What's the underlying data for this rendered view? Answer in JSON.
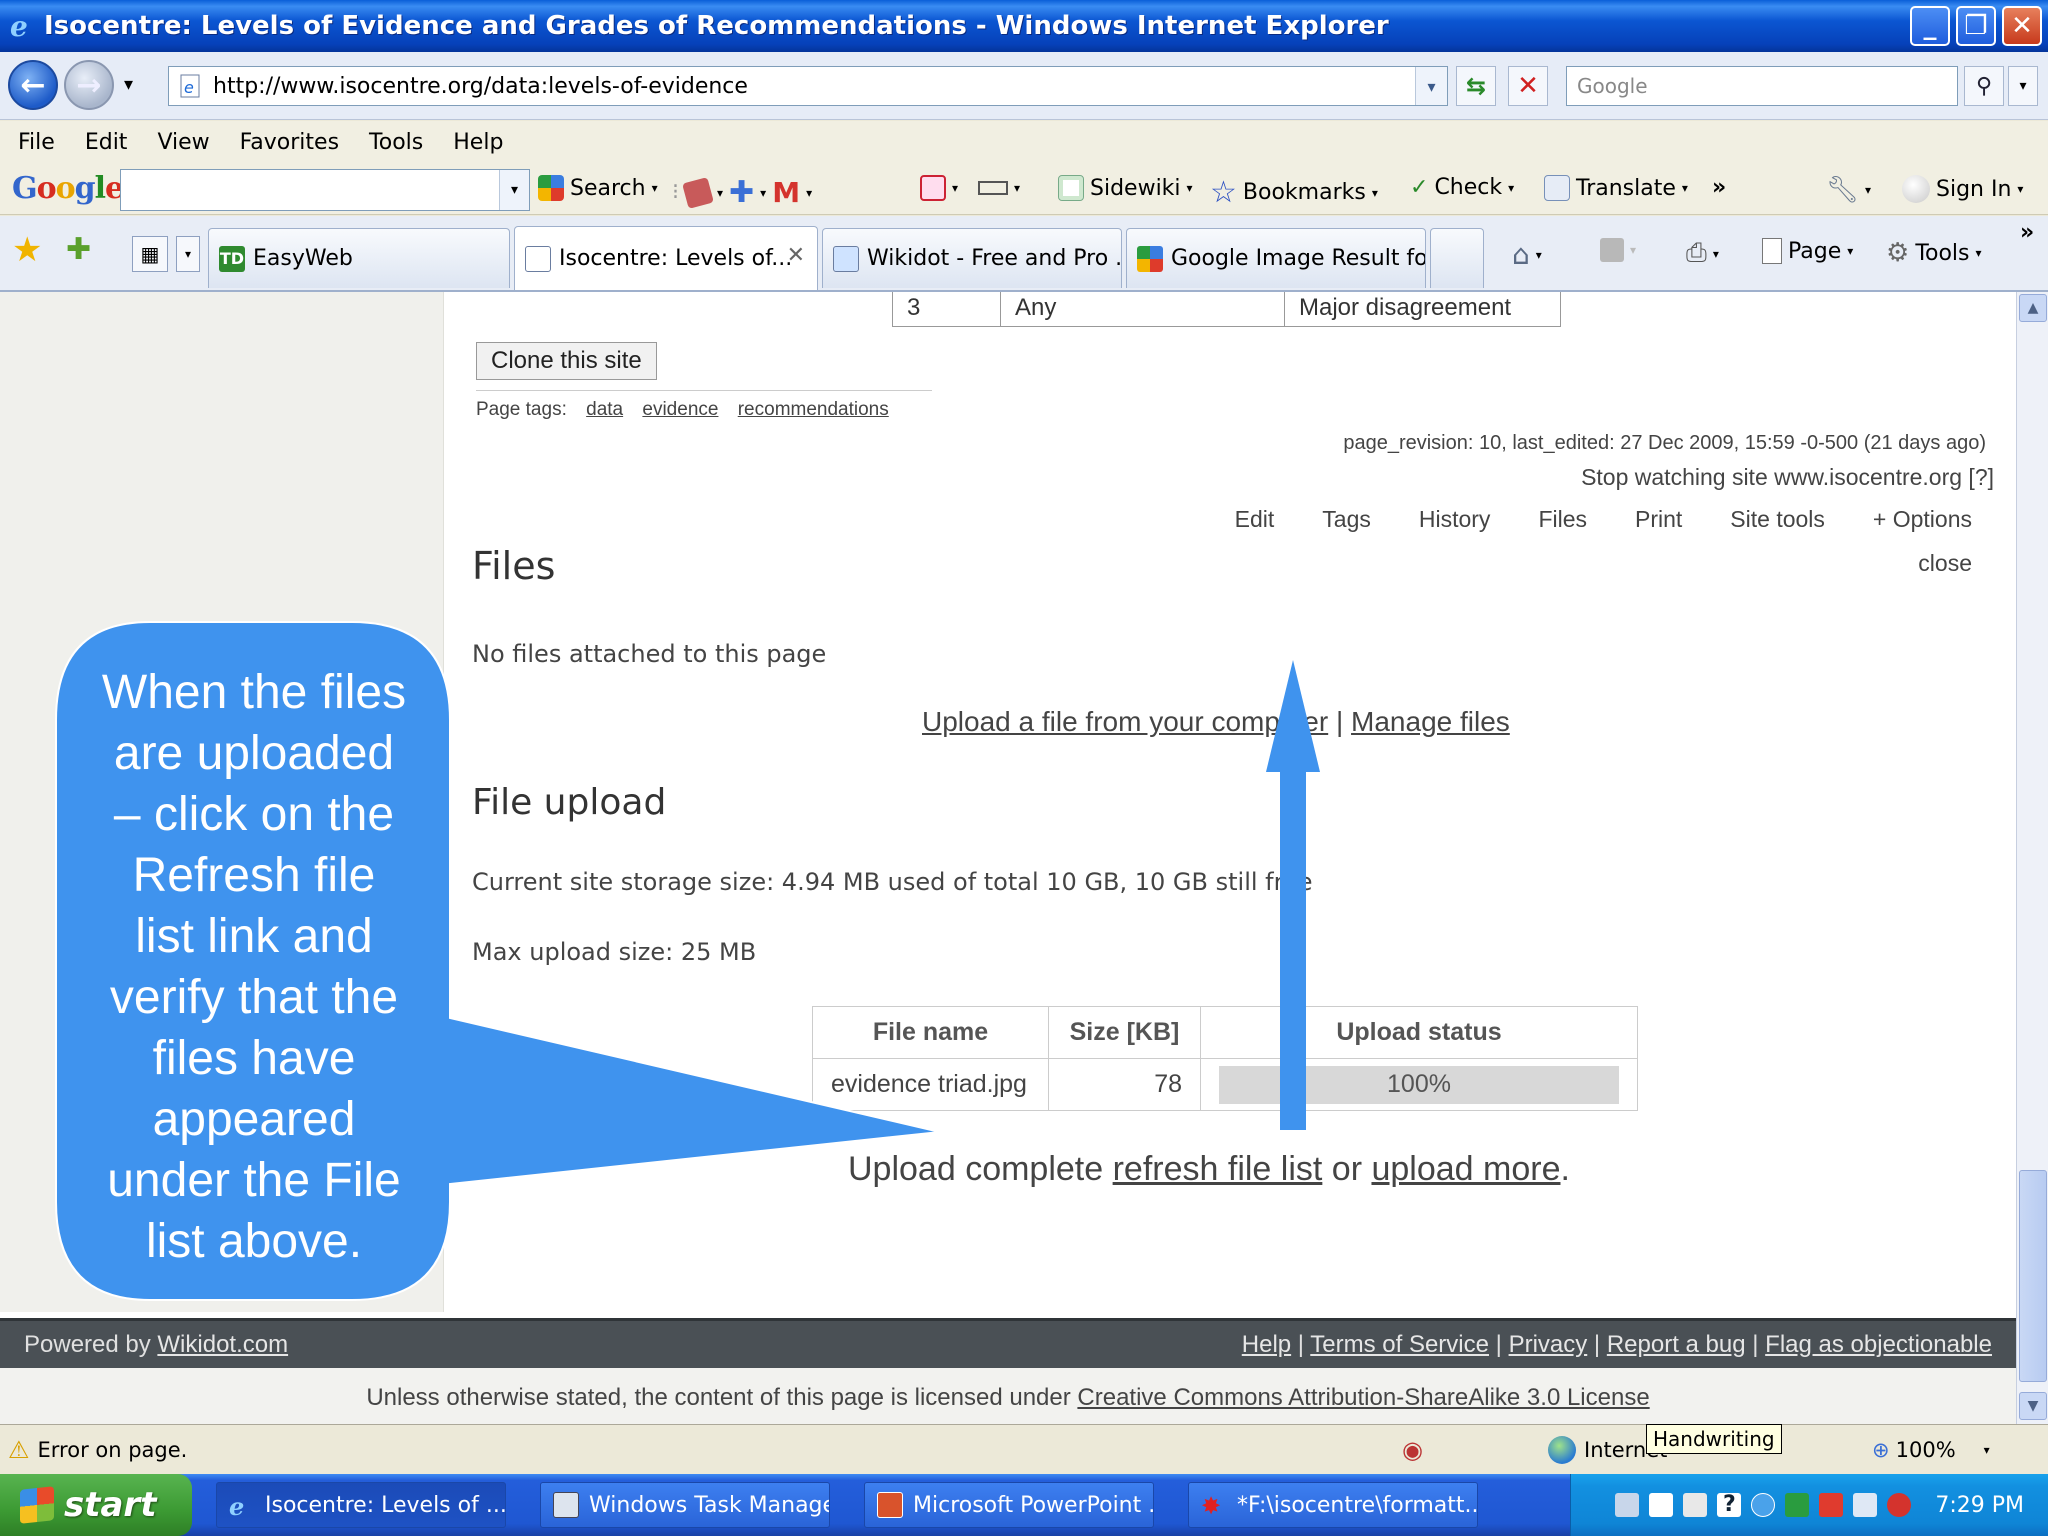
{
  "window": {
    "title": "Isocentre: Levels of Evidence and Grades of Recommendations - Windows Internet Explorer",
    "buttons": {
      "minimize": "_",
      "maximize": "❐",
      "close": "✕"
    }
  },
  "address_bar": {
    "url": "http://www.isocentre.org/data:levels-of-evidence",
    "search_placeholder": "Google"
  },
  "menu": [
    "File",
    "Edit",
    "View",
    "Favorites",
    "Tools",
    "Help"
  ],
  "google_toolbar": {
    "logo": [
      "G",
      "o",
      "o",
      "g",
      "l",
      "e"
    ],
    "search_label": "Search",
    "sidewiki_label": "Sidewiki",
    "bookmarks_label": "Bookmarks",
    "check_label": "Check",
    "translate_label": "Translate",
    "more": "»",
    "signin_label": "Sign In"
  },
  "tabs": [
    {
      "label": "EasyWeb",
      "active": false
    },
    {
      "label": "Isocentre: Levels of...",
      "active": true
    },
    {
      "label": "Wikidot - Free and Pro ...",
      "active": false
    },
    {
      "label": "Google Image Result fo...",
      "active": false
    }
  ],
  "command_bar": {
    "page_label": "Page",
    "tools_label": "Tools",
    "more": "»"
  },
  "page": {
    "table_row": {
      "level": "3",
      "col2": "Any",
      "col3": "Major disagreement"
    },
    "clone_button": "Clone this site",
    "tags_label": "Page tags:",
    "tags": [
      "data",
      "evidence",
      "recommendations"
    ],
    "page_info": "page_revision: 10, last_edited: 27 Dec 2009, 15:59 -0-500 (21 days ago)",
    "watching": "Stop watching site www.isocentre.org [?]",
    "actions": [
      "Edit",
      "Tags",
      "History",
      "Files",
      "Print",
      "Site tools",
      "+ Options"
    ],
    "close_label": "close",
    "files_heading": "Files",
    "no_files": "No files attached to this page",
    "upload_link": "Upload a file from your computer",
    "separator": "|",
    "manage_link": "Manage files",
    "upload_heading": "File upload",
    "storage_text": "Current site storage size: 4.94 MB used of total 10 GB, 10 GB still free",
    "max_upload": "Max upload size: 25 MB",
    "upload_table": {
      "headers": [
        "File name",
        "Size [KB]",
        "Upload status"
      ],
      "rows": [
        {
          "name": "evidence triad.jpg",
          "size": "78",
          "status": "100%",
          "progress": 1.0
        }
      ]
    },
    "upload_complete_prefix": "Upload complete ",
    "refresh_link": "refresh file list",
    "or_text": " or ",
    "upload_more_link": "upload more",
    "period": "."
  },
  "footer": {
    "powered_prefix": "Powered by ",
    "powered_link": "Wikidot.com",
    "links": [
      "Help",
      "Terms of Service",
      "Privacy",
      "Report a bug",
      "Flag as objectionable"
    ],
    "license_prefix": "Unless otherwise stated, the content of this page is licensed under ",
    "license_link": "Creative Commons Attribution-ShareAlike 3.0 License"
  },
  "status_bar": {
    "error_text": "Error on page.",
    "zone_text": "Internet",
    "tooltip": "Handwriting",
    "zoom": "100%"
  },
  "taskbar": {
    "start_label": "start",
    "items": [
      {
        "label": "Isocentre: Levels of ...",
        "active": true
      },
      {
        "label": "Windows Task Manager",
        "active": false
      },
      {
        "label": "Microsoft PowerPoint ...",
        "active": false
      },
      {
        "label": "*F:\\isocentre\\formatt...",
        "active": false
      }
    ],
    "clock": "7:29 PM"
  },
  "callout": {
    "lines": [
      "When the files",
      "are uploaded",
      "– click on the",
      "Refresh file",
      "list link and",
      "verify that the",
      "files have",
      "appeared",
      "under the File",
      "list above."
    ],
    "color": "#3f93ee"
  }
}
